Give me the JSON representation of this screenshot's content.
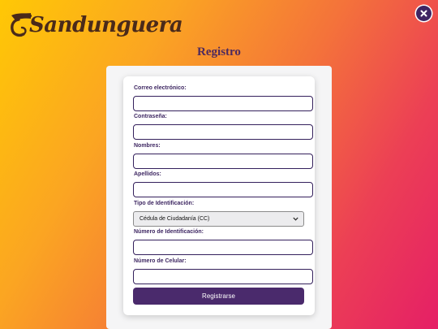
{
  "brand": {
    "name": "Sandunguera"
  },
  "close_icon": "close-icon",
  "page": {
    "title": "Registro"
  },
  "form": {
    "email": {
      "label": "Correo electrónico:",
      "value": ""
    },
    "password": {
      "label": "Contraseña:",
      "value": ""
    },
    "first_names": {
      "label": "Nombres:",
      "value": ""
    },
    "last_names": {
      "label": "Apellidos:",
      "value": ""
    },
    "id_type": {
      "label": "Tipo de Identificación:",
      "selected": "Cédula de Ciudadanía (CC)"
    },
    "id_number": {
      "label": "Número de Identificación:",
      "value": ""
    },
    "phone": {
      "label": "Número de Celular:",
      "value": ""
    },
    "submit_label": "Registrarse"
  },
  "colors": {
    "gradient_start": "#ffc805",
    "gradient_end": "#e51f66",
    "accent": "#4a2a6c",
    "label": "#3e2762"
  }
}
